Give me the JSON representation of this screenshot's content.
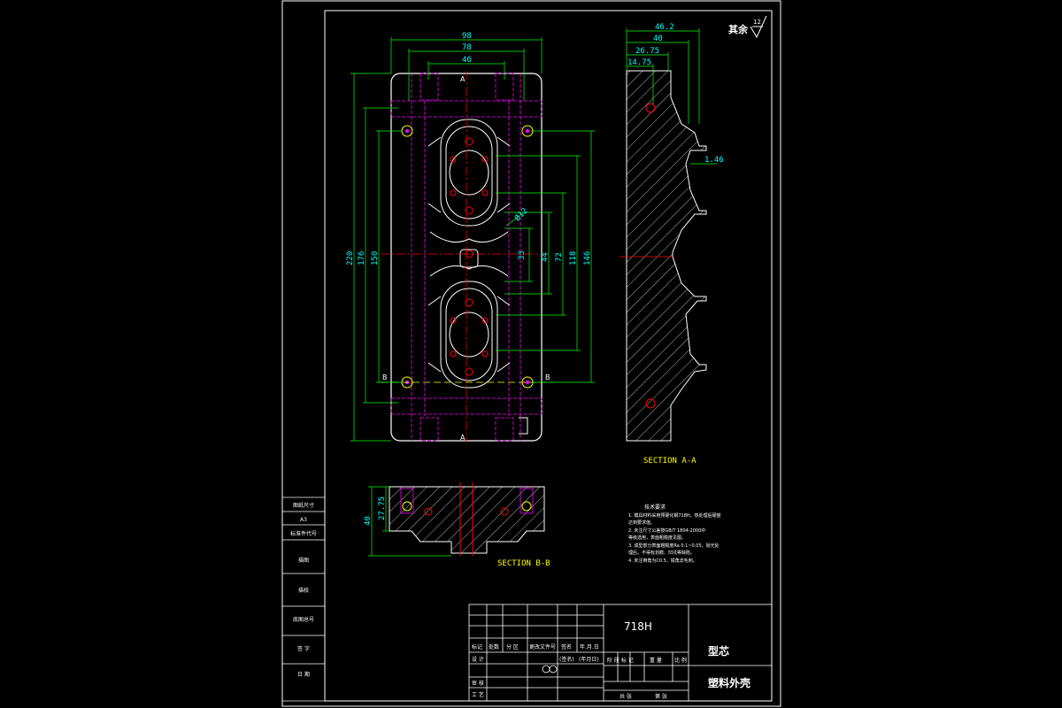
{
  "roughness": {
    "prefix": "其余",
    "value": "12"
  },
  "dims_top": {
    "d98": "98",
    "d78": "78",
    "d46": "46"
  },
  "dims_left": {
    "d220": "220",
    "d176": "176",
    "d150": "150"
  },
  "dims_right": {
    "d146": "146",
    "d118": "118",
    "d72": "72",
    "d44": "44",
    "d33": "33",
    "phi": "Ø12"
  },
  "dims_section_top": {
    "d46_2": "46.2",
    "d40": "40",
    "d26_75": "26.75",
    "d14_75": "14.75",
    "d1_46": "1.46"
  },
  "dims_bb": {
    "d40": "40",
    "d27_75": "27.75"
  },
  "section_marks": {
    "a": "A",
    "b": "B"
  },
  "section_aa_label": "SECTION A-A",
  "section_bb_label": "SECTION B-B",
  "tech_requirements": {
    "title": "技术要求",
    "items": [
      "1. 模具材料采用预硬化钢718H，热处理后硬度",
      "   达到要求值。",
      "2. 未注尺寸公差按GB/T 1804-2000中",
      "   等级选用，表面粗糙度见图。",
      "3. 成型部分表面粗糙度Ra 0.1~0.05，抛光处",
      "   理后，不得有划痕、凹坑等缺陷。",
      "4. 未注倒角为C0.5，锐角去毛刺。"
    ]
  },
  "left_strip": [
    "图纸尺寸",
    "A3",
    "标准件代号",
    "描图",
    "描校",
    "底图总号",
    "签 字",
    "日 期"
  ],
  "title_block": {
    "material": "718H",
    "part_name": "型芯",
    "product_name": "塑料外壳",
    "header_cells": [
      "标记",
      "处数",
      "分 区",
      "更改文件号",
      "签名",
      "年.月.日"
    ],
    "row_design": [
      "设 计",
      "(签名)",
      "(年月日)"
    ],
    "row_check": [
      "审 核"
    ],
    "row_process": [
      "工 艺"
    ],
    "stage_cells": [
      "阶 段 标 记",
      "重 量",
      "比 例"
    ],
    "sheet_cells": [
      "共 张",
      "第 张"
    ]
  },
  "colors": {
    "cyan": "#00ffff",
    "magenta": "#ff00ff",
    "white": "#ffffff",
    "yellow": "#ffff00",
    "red": "#ff0000",
    "green": "#00ff00"
  }
}
